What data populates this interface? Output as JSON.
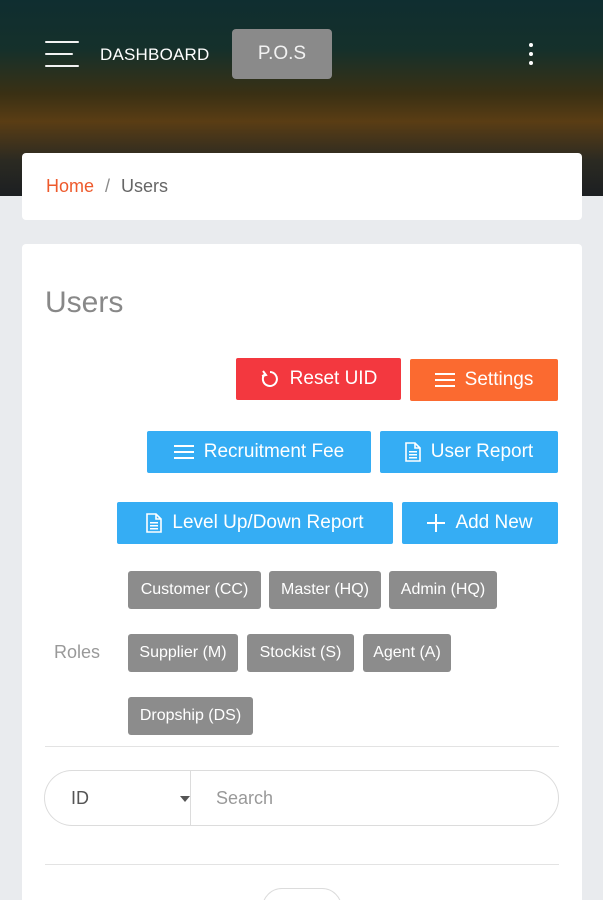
{
  "header": {
    "dashboard_label": "DASHBOARD",
    "pos_label": "P.O.S",
    "menu_icon": "hamburger-icon",
    "more_icon": "kebab-menu-icon"
  },
  "breadcrumb": {
    "home": "Home",
    "separator": "/",
    "current": "Users"
  },
  "page": {
    "title": "Users"
  },
  "actions": {
    "reset_uid": "Reset UID",
    "settings": "Settings",
    "recruitment_fee": "Recruitment Fee",
    "user_report": "User Report",
    "level_report": "Level Up/Down Report",
    "add_new": "Add New"
  },
  "roles": {
    "label": "Roles",
    "items": [
      "Customer (CC)",
      "Master (HQ)",
      "Admin (HQ)",
      "Supplier (M)",
      "Stockist (S)",
      "Agent (A)",
      "Dropship (DS)"
    ]
  },
  "search": {
    "field_value": "ID",
    "placeholder": "Search"
  },
  "colors": {
    "accent_home_link": "#ee5a2c",
    "danger": "#f3383f",
    "warning": "#fb6a30",
    "info": "#35adf4",
    "role_chip": "#8c8c8c",
    "pos_button": "#8a8a8a"
  }
}
